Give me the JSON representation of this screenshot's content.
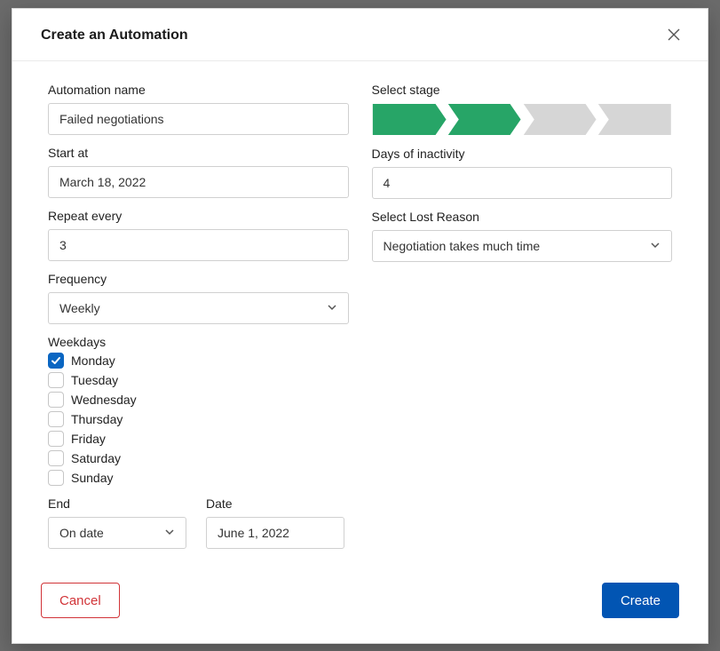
{
  "modal": {
    "title": "Create an Automation"
  },
  "left": {
    "name_label": "Automation name",
    "name_value": "Failed negotiations",
    "start_label": "Start at",
    "start_value": "March 18, 2022",
    "repeat_label": "Repeat every",
    "repeat_value": "3",
    "frequency_label": "Frequency",
    "frequency_value": "Weekly",
    "weekdays_label": "Weekdays",
    "weekdays": [
      {
        "label": "Monday",
        "checked": true
      },
      {
        "label": "Tuesday",
        "checked": false
      },
      {
        "label": "Wednesday",
        "checked": false
      },
      {
        "label": "Thursday",
        "checked": false
      },
      {
        "label": "Friday",
        "checked": false
      },
      {
        "label": "Saturday",
        "checked": false
      },
      {
        "label": "Sunday",
        "checked": false
      }
    ],
    "end_label": "End",
    "end_value": "On date",
    "date_label": "Date",
    "date_value": "June 1, 2022"
  },
  "right": {
    "stage_label": "Select stage",
    "stage_colors": [
      "#27a567",
      "#27a567",
      "#d6d6d6",
      "#d6d6d6"
    ],
    "inactivity_label": "Days of inactivity",
    "inactivity_value": "4",
    "lost_label": "Select Lost Reason",
    "lost_value": "Negotiation takes much time"
  },
  "footer": {
    "cancel": "Cancel",
    "create": "Create"
  }
}
